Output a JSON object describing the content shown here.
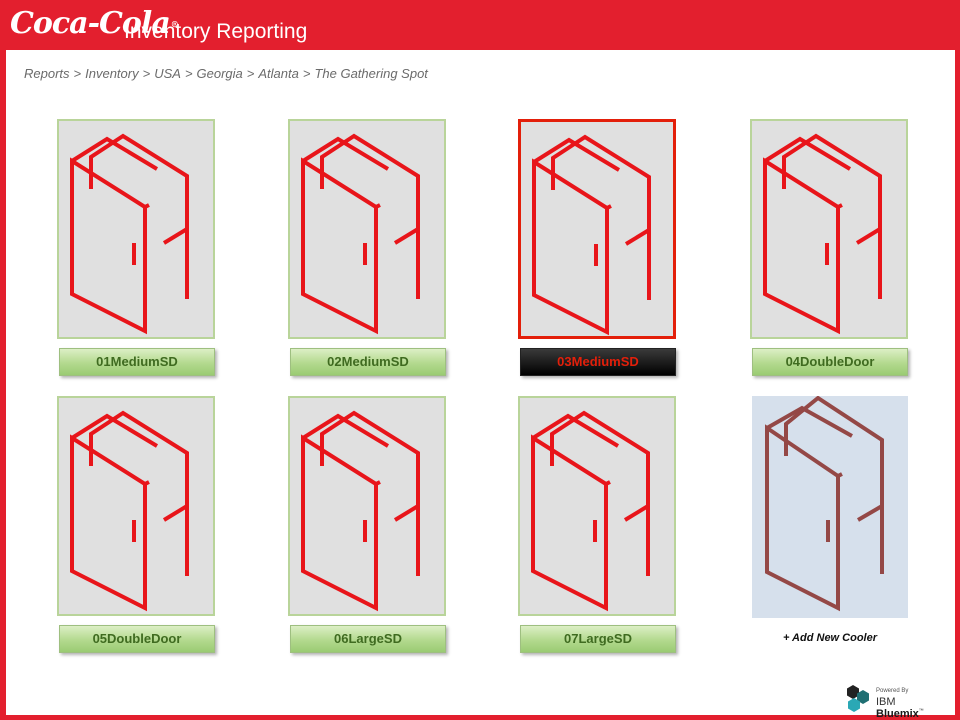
{
  "header": {
    "logo_text": "Coca-Cola",
    "logo_tm": "®",
    "title": "Inventory Reporting"
  },
  "breadcrumb": {
    "separator": ">",
    "items": [
      "Reports",
      "Inventory",
      "USA",
      "Georgia",
      "Atlanta",
      "The Gathering Spot"
    ]
  },
  "coolers": [
    {
      "label": "01MediumSD",
      "selected": false
    },
    {
      "label": "02MediumSD",
      "selected": false
    },
    {
      "label": "03MediumSD",
      "selected": true
    },
    {
      "label": "04DoubleDoor",
      "selected": false
    },
    {
      "label": "05DoubleDoor",
      "selected": false
    },
    {
      "label": "06LargeSD",
      "selected": false
    },
    {
      "label": "07LargeSD",
      "selected": false
    }
  ],
  "add_cooler": {
    "label": "+ Add New Cooler"
  },
  "footer": {
    "powered_by": "Powered By",
    "brand_prefix": "IBM",
    "brand_name": "Bluemix",
    "brand_tm": "™"
  },
  "colors": {
    "brand_red": "#e31f2e",
    "cooler_line": "#e8151a",
    "add_cooler_line": "#944846",
    "label_green": "#b3d98e",
    "label_text": "#3f6b20"
  },
  "icons": {
    "cooler": "open-cooler-door-icon",
    "bluemix": "bluemix-hexagon-logo"
  }
}
